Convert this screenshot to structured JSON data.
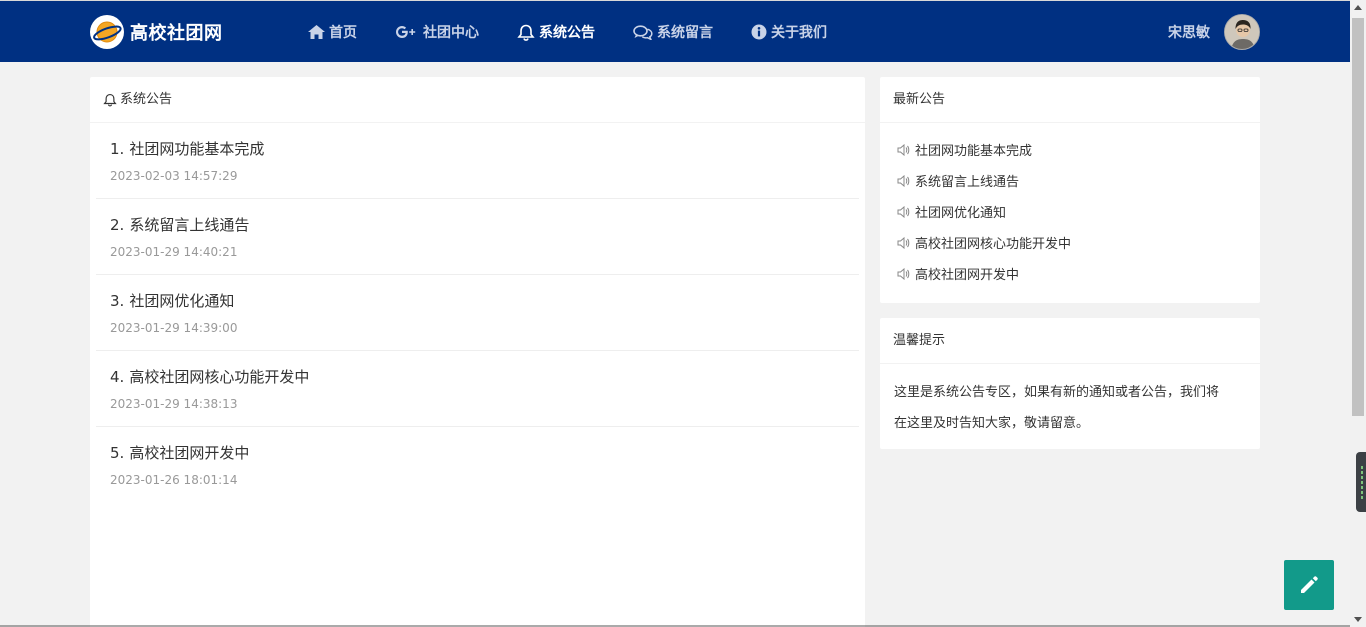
{
  "header": {
    "logo_text": "高校社团网",
    "nav": [
      {
        "label": "首页",
        "icon": "home-icon",
        "active": false
      },
      {
        "label": "社团中心",
        "icon": "google-plus-icon",
        "active": false
      },
      {
        "label": "系统公告",
        "icon": "bell-icon",
        "active": true
      },
      {
        "label": "系统留言",
        "icon": "chat-bubbles-icon",
        "active": false
      },
      {
        "label": "关于我们",
        "icon": "info-icon",
        "active": false
      }
    ],
    "user_name": "宋思敏"
  },
  "main": {
    "title": "系统公告",
    "notices": [
      {
        "index": "1.",
        "title": "社团网功能基本完成",
        "time": "2023-02-03 14:57:29"
      },
      {
        "index": "2.",
        "title": "系统留言上线通告",
        "time": "2023-01-29 14:40:21"
      },
      {
        "index": "3.",
        "title": "社团网优化通知",
        "time": "2023-01-29 14:39:00"
      },
      {
        "index": "4.",
        "title": "高校社团网核心功能开发中",
        "time": "2023-01-29 14:38:13"
      },
      {
        "index": "5.",
        "title": "高校社团网开发中",
        "time": "2023-01-26 18:01:14"
      }
    ]
  },
  "latest": {
    "title": "最新公告",
    "items": [
      "社团网功能基本完成",
      "系统留言上线通告",
      "社团网优化通知",
      "高校社团网核心功能开发中",
      "高校社团网开发中"
    ]
  },
  "tips": {
    "title": "温馨提示",
    "line1": "这里是系统公告专区，如果有新的通知或者公告，我们将",
    "line2": "在这里及时告知大家，敬请留意。"
  },
  "colors": {
    "header_bg": "#003082",
    "fab_bg": "#129a8a"
  }
}
